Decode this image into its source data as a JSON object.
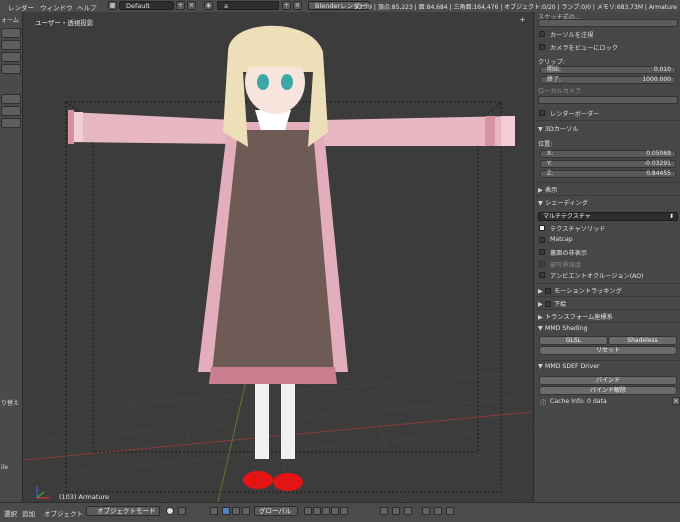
{
  "topbar": {
    "menus": [
      "レンダー",
      "ウィンドウ",
      "ヘルプ"
    ],
    "layout_field": "Default",
    "scene_field": "a",
    "engine_field": "Blenderレンダー",
    "stats": "v2.79 | 頂点:85,223 | 面:84,684 | 三角面:164,476 | オブジェクト:0/20 | ランプ:0/0 | メモリ:683.73M | Armature"
  },
  "tool_shelf": {
    "label_top": "ォーム",
    "label_mid": "り替え",
    "label_bottom": "ile"
  },
  "viewport": {
    "view_label": "ユーザー・透視投影",
    "object_label": "(103) Armature"
  },
  "properties": {
    "top_label": "スケッチ式の…",
    "checkbox_cursor_focus": "カーソルを注視",
    "checkbox_lock_camera": "カメラをビューにロック",
    "clip_label": "クリップ:",
    "clip_start_key": "開始:",
    "clip_start_val": "0.010",
    "clip_end_key": "終了:",
    "clip_end_val": "1000.000",
    "local_camera": "ローカルカメラ",
    "checkbox_render_border": "レンダーボーダー",
    "section_3d_cursor": "3Dカーソル",
    "position_label": "位置:",
    "cursor_x_key": "X:",
    "cursor_x_val": "0.05069",
    "cursor_y_key": "Y:",
    "cursor_y_val": "-0.03291",
    "cursor_z_key": "Z:",
    "cursor_z_val": "0.84455",
    "section_display": "表示",
    "section_shading": "シェーディング",
    "shading_mode": "マルチテクスチャ",
    "chk_texture_solid": "テクスチャソリッド",
    "chk_matcap": "Matcap",
    "chk_backface": "裏面の非表示",
    "chk_depth": "被写界深度",
    "chk_ao": "アンビエントオクルージョン(AO)",
    "section_motion_tracking": "モーショントラッキング",
    "section_background": "下絵",
    "section_transform_orient": "トランスフォーム座標系",
    "section_mmd_shading": "MMD Shading",
    "btn_glsl": "GLSL",
    "btn_shadeless": "Shadeless",
    "btn_reset": "リセット",
    "section_mmd_sdef": "MMD SDEF Driver",
    "btn_bind": "バインド",
    "btn_unbind": "バインド解除",
    "cache_info": "Cache Info: 0 data"
  },
  "bottombar": {
    "menu_select": "選択",
    "menu_add": "追加",
    "menu_object": "オブジェクト",
    "mode": "オブジェクトモード",
    "orientation": "グローバル"
  },
  "colors": {
    "panel_bg": "#474747",
    "viewport_bg": "#3c3c3c",
    "grid_red": "#9b3a3a",
    "grid_green": "#5a8a3a",
    "header_bg": "#4b4b4b"
  }
}
